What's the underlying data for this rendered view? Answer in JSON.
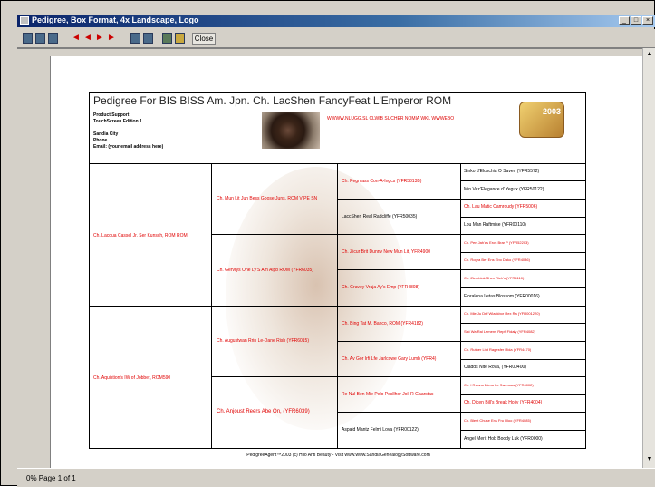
{
  "window": {
    "title": "Pedigree, Box Format, 4x Landscape, Logo",
    "minimize_glyph": "_",
    "maximize_glyph": "□",
    "close_glyph": "×",
    "icon": "app-icon"
  },
  "toolbar": {
    "nav_first": "◄",
    "nav_prev": "◄",
    "nav_next": "►",
    "nav_last": "►",
    "close_label": "Close",
    "icons": [
      "view-icon",
      "pages-icon",
      "zoom-icon",
      "print-icon",
      "export-icon",
      "save-icon",
      "open-icon"
    ]
  },
  "status": {
    "text": "0% Page 1 of 1"
  },
  "scrollbar": {
    "up_arrow": "▲",
    "down_arrow": "▼"
  },
  "document": {
    "title": "Pedigree For BIS BISS Am. Jpn. Ch. LacShen FancyFeat L'Emperor ROM",
    "header_info": [
      "Product Support",
      "TouchScreen Edition 1",
      "Sandia City",
      "Phone",
      "Email: (your email address here)"
    ],
    "header_red": "WWWW.NLUGG.SL CLWIB SUCHER NOMIA WKL WWWEBO",
    "logo_year": "2003",
    "gen1": [
      "Ch. Lacqua Cassel Jr. Ser Kunsch, ROM ROM",
      "Ch. Aquistion's IW of Jobber, ROM590"
    ],
    "gen2": [
      "Ch. Mun Lit Jun Bess Goose Juns, ROM VIPE SN",
      "Ch. Gervrys One Ly'S Am Alpb ROM (YFR6035)",
      "Ch. Augustwan Rrin Le-Dane Rish (YFR6015)",
      "Ch. Anjoust Reers Abe On, (YFR6039)"
    ],
    "gen3": [
      "Ch. Pegmass Con-A-Ingcs (YFR5813B)",
      "LaccShen Real Radcliffe (YFR50035)",
      "Ch. Zicur Brit Dunnv New Mun Lit, YFR4900",
      "Ch. Gravey Vraja Ay's Emp (YFR4808)",
      "Ch. Bing Tat M. Banco, ROM (YFR4182)",
      "Ch. Av Gor Irfi Lfe Jarlcowe Gary Lumb (YFR4)",
      "Re Nul Ben Mie Pelo Pesllhor Joll R Gaarstac",
      "Aspaid Mantz Felmi Lova (YFR00122)"
    ],
    "gen4": [
      "Sinko d'Eloschia O Saver, (YFR5572)",
      "Min Vez'Elegance d' Yegux (YFR50122)",
      "Ch. Lau Matic Camroudy (YFR5006)",
      "Lou Man Raftmise (YFR00110)",
      "Ch. Pen Jah'as Eros Brar P (YFR52203)",
      "Ch. Rogra Ber Ens Ebo Dako (YFR4036)",
      "Ch. Ziembluk Shen Rich's (YFR4110)",
      "Floralena Letas Blossom (YFR00016)",
      "Ch. Mie Ju Drlf Wlackbor Rex Ra (YFR001220)",
      "Sist Wa Ral Lemens Repfi Fidaly (YFR4082)",
      "Ch. Rutner Liut Ragesfer Rida (YFR4470)",
      "Ciadds Nite Rova, (YFR00400)",
      "Ch. I Rwans Bienu Le Swensus (YFR4002)",
      "Ch. Dicen Bill's Break Holiy (YFR4004)",
      "Ch. Blest Chuse Ens Fru Iilloo (YFR4085)",
      "Angel Merit Hob Boody Luk (YFR0000)"
    ],
    "footer": "PedigreeAgent™2003 (c) Hilo Anti Beauty - Visit www.www.SandiaGenealogySoftware.com"
  }
}
